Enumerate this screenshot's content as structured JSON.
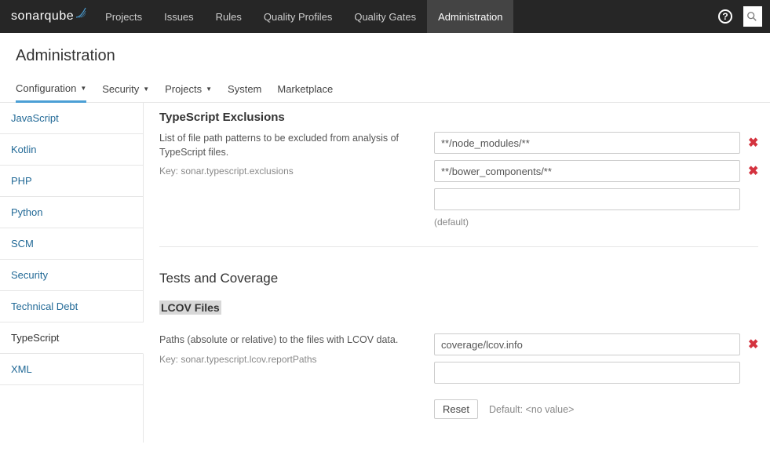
{
  "brand": {
    "name_part1": "sonar",
    "name_part2": "qube"
  },
  "topnav": {
    "items": [
      {
        "label": "Projects"
      },
      {
        "label": "Issues"
      },
      {
        "label": "Rules"
      },
      {
        "label": "Quality Profiles"
      },
      {
        "label": "Quality Gates"
      },
      {
        "label": "Administration"
      }
    ]
  },
  "page": {
    "title": "Administration"
  },
  "subnav": {
    "items": [
      {
        "label": "Configuration"
      },
      {
        "label": "Security"
      },
      {
        "label": "Projects"
      },
      {
        "label": "System"
      },
      {
        "label": "Marketplace"
      }
    ]
  },
  "sidebar": {
    "items": [
      {
        "label": "JavaScript"
      },
      {
        "label": "Kotlin"
      },
      {
        "label": "PHP"
      },
      {
        "label": "Python"
      },
      {
        "label": "SCM"
      },
      {
        "label": "Security"
      },
      {
        "label": "Technical Debt"
      },
      {
        "label": "TypeScript"
      },
      {
        "label": "XML"
      }
    ]
  },
  "settings": {
    "exclusions": {
      "title": "TypeScript Exclusions",
      "desc": "List of file path patterns to be excluded from analysis of TypeScript files.",
      "key": "Key: sonar.typescript.exclusions",
      "values": [
        "**/node_modules/**",
        "**/bower_components/**",
        ""
      ],
      "default_note": "(default)"
    },
    "tests_section_title": "Tests and Coverage",
    "lcov": {
      "title": "LCOV Files",
      "desc": "Paths (absolute or relative) to the files with LCOV data.",
      "key": "Key: sonar.typescript.lcov.reportPaths",
      "values": [
        "coverage/lcov.info",
        ""
      ],
      "reset_label": "Reset",
      "default_label": "Default: <no value>"
    }
  }
}
